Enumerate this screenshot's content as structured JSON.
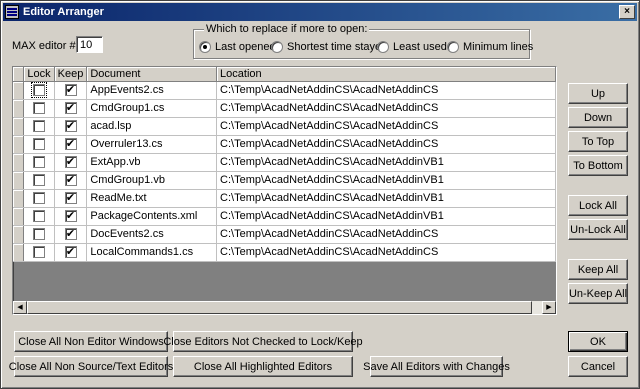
{
  "window": {
    "title": "Editor Arranger",
    "close_label": "×"
  },
  "max_editor": {
    "label": "MAX editor #:",
    "value": "10"
  },
  "replace_group": {
    "legend": "Which to replace if more to open:",
    "options": [
      {
        "label": "Last opened",
        "selected": true
      },
      {
        "label": "Shortest time stayed",
        "selected": false
      },
      {
        "label": "Least used",
        "selected": false
      },
      {
        "label": "Minimum lines",
        "selected": false
      }
    ]
  },
  "grid": {
    "columns": {
      "lock": "Lock",
      "keep": "Keep",
      "document": "Document",
      "location": "Location"
    },
    "rows": [
      {
        "lock": false,
        "keep": true,
        "document": "AppEvents2.cs",
        "location": "C:\\Temp\\AcadNetAddinCS\\AcadNetAddinCS"
      },
      {
        "lock": false,
        "keep": true,
        "document": "CmdGroup1.cs",
        "location": "C:\\Temp\\AcadNetAddinCS\\AcadNetAddinCS"
      },
      {
        "lock": false,
        "keep": true,
        "document": "acad.lsp",
        "location": "C:\\Temp\\AcadNetAddinCS\\AcadNetAddinCS"
      },
      {
        "lock": false,
        "keep": true,
        "document": "Overruler13.cs",
        "location": "C:\\Temp\\AcadNetAddinCS\\AcadNetAddinCS"
      },
      {
        "lock": false,
        "keep": true,
        "document": "ExtApp.vb",
        "location": "C:\\Temp\\AcadNetAddinCS\\AcadNetAddinVB1"
      },
      {
        "lock": false,
        "keep": true,
        "document": "CmdGroup1.vb",
        "location": "C:\\Temp\\AcadNetAddinCS\\AcadNetAddinVB1"
      },
      {
        "lock": false,
        "keep": true,
        "document": "ReadMe.txt",
        "location": "C:\\Temp\\AcadNetAddinCS\\AcadNetAddinVB1"
      },
      {
        "lock": false,
        "keep": true,
        "document": "PackageContents.xml",
        "location": "C:\\Temp\\AcadNetAddinCS\\AcadNetAddinVB1"
      },
      {
        "lock": false,
        "keep": true,
        "document": "DocEvents2.cs",
        "location": "C:\\Temp\\AcadNetAddinCS\\AcadNetAddinCS"
      },
      {
        "lock": false,
        "keep": true,
        "document": "LocalCommands1.cs",
        "location": "C:\\Temp\\AcadNetAddinCS\\AcadNetAddinCS"
      }
    ]
  },
  "side_buttons": {
    "up": "Up",
    "down": "Down",
    "to_top": "To Top",
    "to_bottom": "To Bottom",
    "lock_all": "Lock All",
    "unlock_all": "Un-Lock All",
    "keep_all": "Keep All",
    "unkeep_all": "Un-Keep All"
  },
  "bottom_buttons": {
    "close_non_editor": "Close All Non Editor Windows",
    "close_not_checked": "Close Editors Not Checked to Lock/Keep",
    "close_non_source": "Close All Non Source/Text Editors",
    "close_highlighted": "Close All Highlighted Editors",
    "save_all": "Save All Editors with Changes"
  },
  "dialog_buttons": {
    "ok": "OK",
    "cancel": "Cancel"
  },
  "icons": {
    "check": "✔",
    "arrow_left": "◀",
    "arrow_right": "▶"
  }
}
